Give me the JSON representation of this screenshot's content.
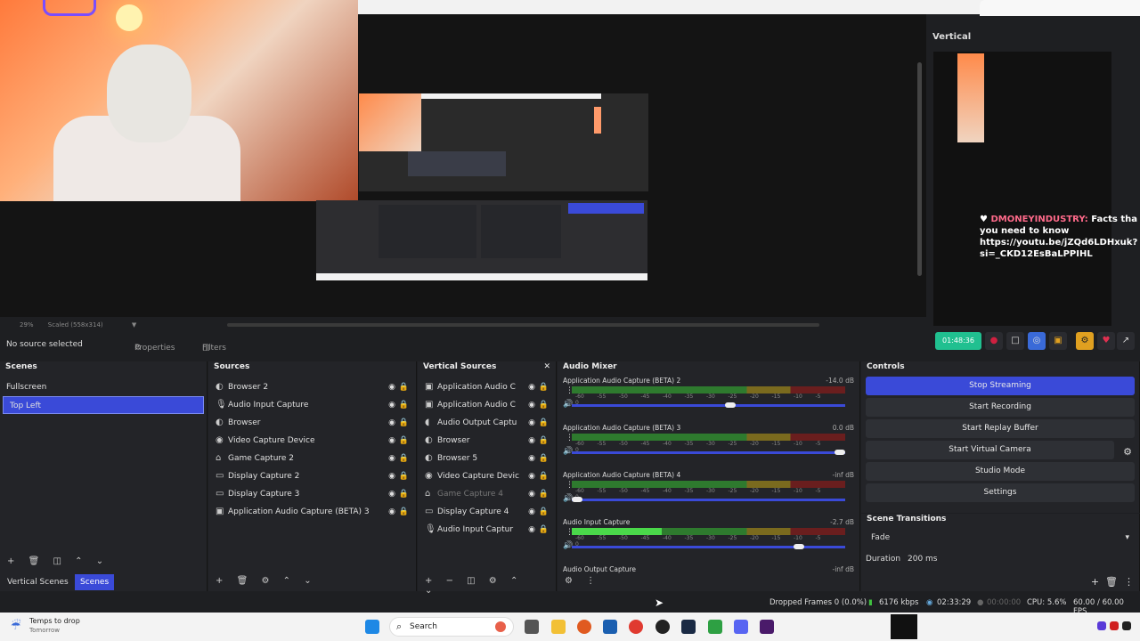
{
  "preview": {
    "zoom_text": "29%",
    "scaled_text": "Scaled (558x314)",
    "vertical_title": "Vertical"
  },
  "chat": {
    "username": "DMONEYINDUSTRY:",
    "message": "Facts tha you need to know https://youtu.be/jZQd6LDHxuk?si=_CKD12EsBaLPPIHL"
  },
  "vertical_controls": {
    "timer": "01:48:36"
  },
  "statusbar": {
    "no_source": "No source selected",
    "properties": "Properties",
    "filters": "Filters"
  },
  "scenes": {
    "title": "Scenes",
    "items": [
      "Fullscreen",
      "Top Left"
    ],
    "selected": "Top Left",
    "tabs": [
      "Vertical Scenes",
      "Scenes"
    ]
  },
  "sources": {
    "title": "Sources",
    "items": [
      {
        "icon": "browser-icon",
        "glyph": "◐",
        "label": "Browser 2"
      },
      {
        "icon": "microphone-icon",
        "glyph": "🎙",
        "label": "Audio Input Capture"
      },
      {
        "icon": "browser-icon",
        "glyph": "◐",
        "label": "Browser"
      },
      {
        "icon": "camera-icon",
        "glyph": "◉",
        "label": "Video Capture Device"
      },
      {
        "icon": "gamepad-icon",
        "glyph": "⌂",
        "label": "Game Capture 2"
      },
      {
        "icon": "monitor-icon",
        "glyph": "▭",
        "label": "Display Capture 2"
      },
      {
        "icon": "monitor-icon",
        "glyph": "▭",
        "label": "Display Capture 3"
      },
      {
        "icon": "app-audio-icon",
        "glyph": "▣",
        "label": "Application Audio Capture (BETA) 3"
      }
    ]
  },
  "vertical_sources": {
    "title": "Vertical Sources",
    "items": [
      {
        "icon": "app-audio-icon",
        "glyph": "▣",
        "label": "Application Audio C",
        "dim": false
      },
      {
        "icon": "app-audio-icon",
        "glyph": "▣",
        "label": "Application Audio C",
        "dim": false
      },
      {
        "icon": "speaker-icon",
        "glyph": "◖",
        "label": "Audio Output Captu",
        "dim": false
      },
      {
        "icon": "browser-icon",
        "glyph": "◐",
        "label": "Browser",
        "dim": false
      },
      {
        "icon": "browser-icon",
        "glyph": "◐",
        "label": "Browser 5",
        "dim": false
      },
      {
        "icon": "camera-icon",
        "glyph": "◉",
        "label": "Video Capture Devic",
        "dim": false
      },
      {
        "icon": "gamepad-icon",
        "glyph": "⌂",
        "label": "Game Capture 4",
        "dim": true
      },
      {
        "icon": "monitor-icon",
        "glyph": "▭",
        "label": "Display Capture 4",
        "dim": false
      },
      {
        "icon": "microphone-icon",
        "glyph": "🎙",
        "label": "Audio Input Captur",
        "dim": false
      }
    ]
  },
  "audio_mixer": {
    "title": "Audio Mixer",
    "ticks": [
      "-60",
      "-55",
      "-50",
      "-45",
      "-40",
      "-35",
      "-30",
      "-25",
      "-20",
      "-15",
      "-10",
      "-5",
      "0"
    ],
    "channels": [
      {
        "name": "Application Audio Capture (BETA) 2",
        "db": "-14.0 dB",
        "level": 0.0,
        "volume": 0.6
      },
      {
        "name": "Application Audio Capture (BETA) 3",
        "db": "0.0 dB",
        "level": 0.0,
        "volume": 1.0
      },
      {
        "name": "Application Audio Capture (BETA) 4",
        "db": "-inf dB",
        "level": 0.0,
        "volume": 0.0
      },
      {
        "name": "Audio Input Capture",
        "db": "-2.7 dB",
        "level": 0.33,
        "volume": 0.85
      },
      {
        "name": "Audio Output Capture",
        "db": "-inf dB",
        "level": 0.0,
        "volume": 0.0
      }
    ]
  },
  "controls": {
    "title": "Controls",
    "buttons": [
      "Stop Streaming",
      "Start Recording",
      "Start Replay Buffer",
      "Start Virtual Camera",
      "Studio Mode",
      "Settings"
    ]
  },
  "transitions": {
    "title": "Scene Transitions",
    "selected": "Fade",
    "duration_label": "Duration",
    "duration_value": "200 ms"
  },
  "bottom_status": {
    "dropped": "Dropped Frames 0 (0.0%)",
    "bitrate": "6176 kbps",
    "stream_time": "02:33:29",
    "rec_time": "00:00:00",
    "cpu": "CPU: 5.6%",
    "fps": "60.00 / 60.00 FPS"
  },
  "taskbar": {
    "weather_title": "Temps to drop",
    "weather_sub": "Tomorrow",
    "search_placeholder": "Search"
  }
}
